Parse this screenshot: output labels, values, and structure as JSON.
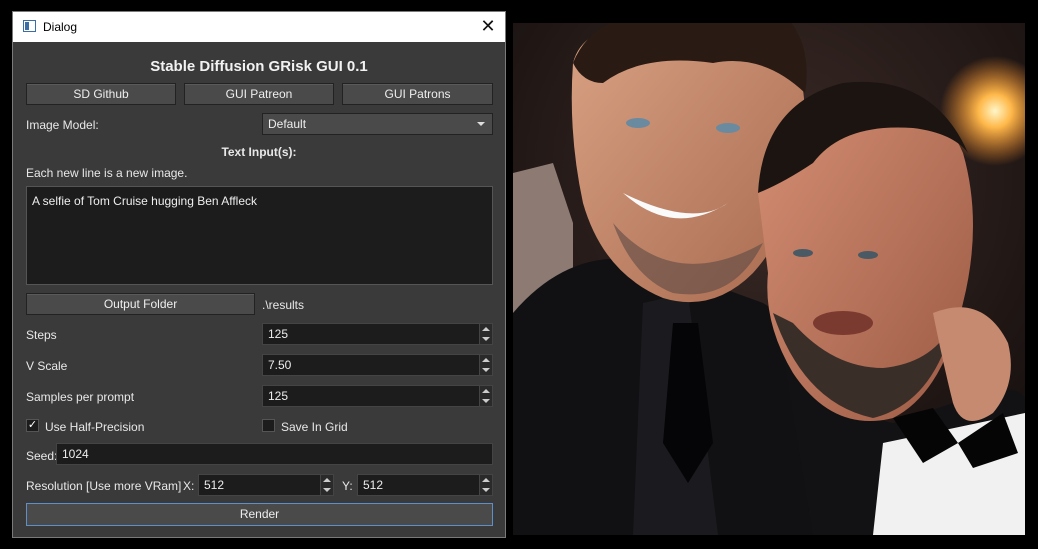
{
  "window": {
    "title": "Dialog",
    "close_glyph": "✕"
  },
  "app": {
    "heading": "Stable Diffusion GRisk GUI 0.1",
    "buttons": {
      "github": "SD Github",
      "patreon": "GUI Patreon",
      "patrons": "GUI Patrons"
    }
  },
  "model": {
    "label": "Image Model:",
    "value": "Default"
  },
  "text_inputs": {
    "heading": "Text Input(s):",
    "hint": "Each new line is a new image.",
    "value": "A selfie of Tom Cruise hugging Ben Affleck"
  },
  "output": {
    "button": "Output Folder",
    "path": ".\\results"
  },
  "steps": {
    "label": "Steps",
    "value": "125"
  },
  "v_scale": {
    "label": "V Scale",
    "value": "7.50"
  },
  "samples": {
    "label": "Samples per prompt",
    "value": "125"
  },
  "half_precision": {
    "label": "Use Half-Precision",
    "checked": true,
    "check_glyph": "✓"
  },
  "save_grid": {
    "label": "Save In Grid",
    "checked": false
  },
  "seed": {
    "label": "Seed:",
    "value": "1024"
  },
  "resolution": {
    "label": "Resolution [Use more VRam]",
    "x_label": "X:",
    "x_value": "512",
    "y_label": "Y:",
    "y_value": "512"
  },
  "render": {
    "label": "Render"
  },
  "colors": {
    "dialog_bg": "#3a3a3a",
    "input_bg": "#1c1c1c",
    "button_bg": "#4a4a4a",
    "focus_border": "#5e8fc7"
  }
}
